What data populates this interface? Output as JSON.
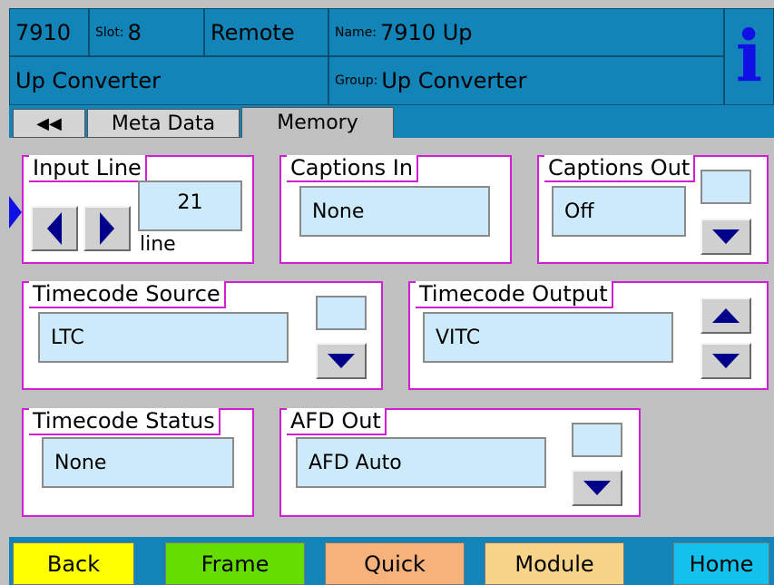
{
  "header": {
    "model": "7910",
    "slot_label": "Slot:",
    "slot_value": "8",
    "mode": "Remote",
    "name_label": "Name:",
    "name_value": "7910 Up",
    "type": "Up Converter",
    "group_label": "Group:",
    "group_value": "Up Converter",
    "info_icon": "i"
  },
  "tabs": {
    "back_icon": "◀◀",
    "items": [
      "Meta Data",
      "Memory"
    ]
  },
  "panels": {
    "input_line": {
      "title": "Input Line",
      "value": "21",
      "unit": "line"
    },
    "captions_in": {
      "title": "Captions In",
      "value": "None"
    },
    "captions_out": {
      "title": "Captions Out",
      "value": "Off"
    },
    "timecode_source": {
      "title": "Timecode Source",
      "value": "LTC"
    },
    "timecode_output": {
      "title": "Timecode Output",
      "value": "VITC"
    },
    "timecode_status": {
      "title": "Timecode Status",
      "value": "None"
    },
    "afd_out": {
      "title": "AFD Out",
      "value": "AFD Auto"
    }
  },
  "bottom": {
    "back": "Back",
    "frame": "Frame",
    "quick": "Quick",
    "module": "Module",
    "home": "Home"
  },
  "colors": {
    "header_blue": "#1284b8",
    "panel_border": "#d21ed2",
    "field_bg": "#cdeafa",
    "back_btn": "#ffff00",
    "frame_btn": "#66dd00",
    "quick_btn": "#f6b27a",
    "module_btn": "#f8d488",
    "home_btn": "#14c0ec"
  }
}
